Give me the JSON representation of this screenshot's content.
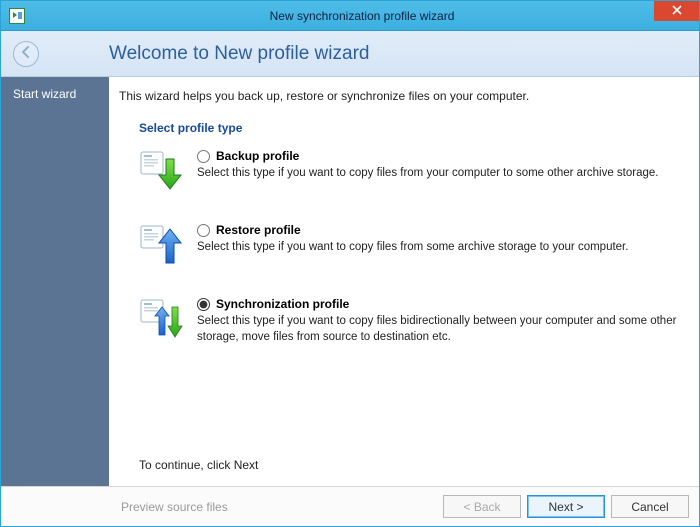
{
  "window": {
    "title": "New synchronization profile wizard"
  },
  "header": {
    "heading": "Welcome to New profile wizard"
  },
  "sidebar": {
    "items": [
      {
        "label": "Start wizard"
      }
    ]
  },
  "content": {
    "intro": "This wizard helps you back up, restore or synchronize files on your computer.",
    "section_heading": "Select profile type",
    "options": [
      {
        "title": "Backup profile",
        "desc": "Select this type if you want to copy files from your computer to some other archive storage.",
        "selected": false
      },
      {
        "title": "Restore profile",
        "desc": "Select this type if you want to copy files from some archive storage to your computer.",
        "selected": false
      },
      {
        "title": "Synchronization profile",
        "desc": "Select this type if you want to copy files bidirectionally between your computer and some other storage, move files from source to destination etc.",
        "selected": true
      }
    ],
    "continue_hint": "To continue, click Next"
  },
  "footer": {
    "preview_label": "Preview source files",
    "back_label": "< Back",
    "next_label": "Next >",
    "cancel_label": "Cancel"
  }
}
